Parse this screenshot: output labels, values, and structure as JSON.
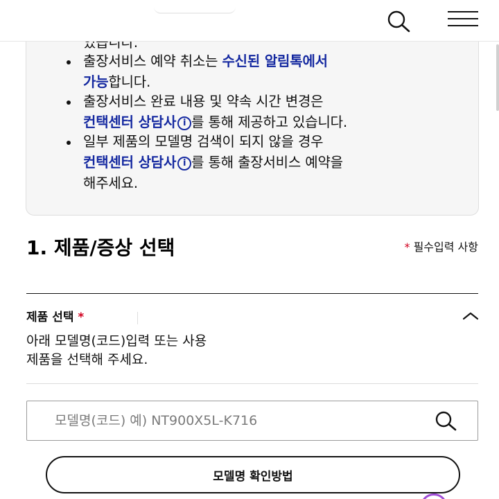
{
  "header": {
    "search_icon": "search-icon",
    "menu_icon": "hamburger-menu-icon"
  },
  "notice": {
    "line0": "있습니다.",
    "item1_text": "출장서비스 예약 취소는 ",
    "item1_link": "수신된 알림톡에서",
    "item1_link2": "가능",
    "item1_suffix": "합니다.",
    "item2_text": "출장서비스 완료 내용 및 약속 시간 변경은",
    "item2_link": "컨택센터 상담사",
    "item2_suffix": "를 통해 제공하고 있습니다.",
    "item3_text": "일부 제품의 모델명 검색이 되지 않을 경우",
    "item3_link": "컨택센터 상담사",
    "item3_suffix": "를 통해 출장서비스 예약을",
    "item3_suffix2": "해주세요.",
    "info_glyph": "i"
  },
  "section": {
    "title": "1. 제품/증상 선택",
    "required_star": "*",
    "required_text": " 필수입력 사항"
  },
  "product": {
    "label": "제품 선택",
    "label_star": "*",
    "desc_line1": "아래 모델명(코드)입력 또는 사용",
    "desc_line2": "제품을 선택해 주세요."
  },
  "model_search": {
    "placeholder": "모델명(코드) 예) NT900X5L-K716",
    "value": ""
  },
  "buttons": {
    "howto_label": "모델명 확인방법"
  },
  "colors": {
    "accent_blue": "#1428a0",
    "required_red": "#d1001f",
    "notice_bg": "#f6f6f6"
  }
}
